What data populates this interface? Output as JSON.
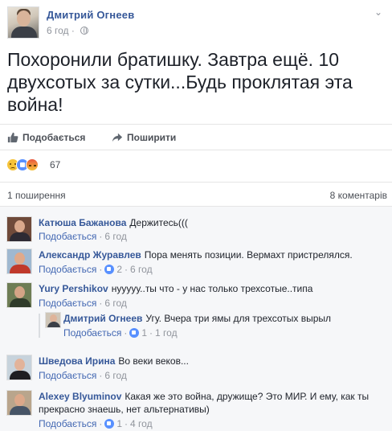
{
  "post": {
    "author": "Дмитрий Огнеев",
    "time": "6 год",
    "text": "Похоронили братишку. Завтра ещё. 10 двухсотых за сутки...Будь проклятая эта война!",
    "menu_glyph": "⌄"
  },
  "actions": {
    "like_label": "Подобається",
    "share_label": "Поширити"
  },
  "reactions": {
    "types": [
      "sad",
      "like",
      "angry"
    ],
    "count": "67"
  },
  "stats": {
    "shares": "1 поширення",
    "comments": "8 коментарів"
  },
  "colors": {
    "link_blue": "#365899",
    "action_blue": "#4267b2",
    "muted": "#90949c",
    "comments_bg": "#f6f7f9"
  },
  "comments": [
    {
      "name": "Катюша Бажанова",
      "text": "Держитесь(((",
      "like_label": "Подобається",
      "likes": "",
      "time": "6 год"
    },
    {
      "name": "Александр Журавлев",
      "text": "Пора менять позиции. Вермахт пристрелялся.",
      "like_label": "Подобається",
      "likes": "2",
      "time": "6 год"
    },
    {
      "name": "Yury Pershikov",
      "text": "нууууу..ты что - у нас только трехсотые..типа",
      "like_label": "Подобається",
      "likes": "",
      "time": "6 год"
    },
    {
      "name": "Шведова Ирина",
      "text": "Во веки веков...",
      "like_label": "Подобається",
      "likes": "",
      "time": "6 год"
    },
    {
      "name": "Alexey Blyuminov",
      "text": "Какая же это война, дружище? Это МИР. И ему, как ты прекрасно знаешь, нет альтернативы)",
      "like_label": "Подобається",
      "likes": "1",
      "time": "4 год"
    }
  ],
  "reply": {
    "name": "Дмитрий Огнеев",
    "text": "Угу. Вчера три ямы для трехсотых вырыл",
    "like_label": "Подобається",
    "likes": "1",
    "time": "1 год"
  }
}
